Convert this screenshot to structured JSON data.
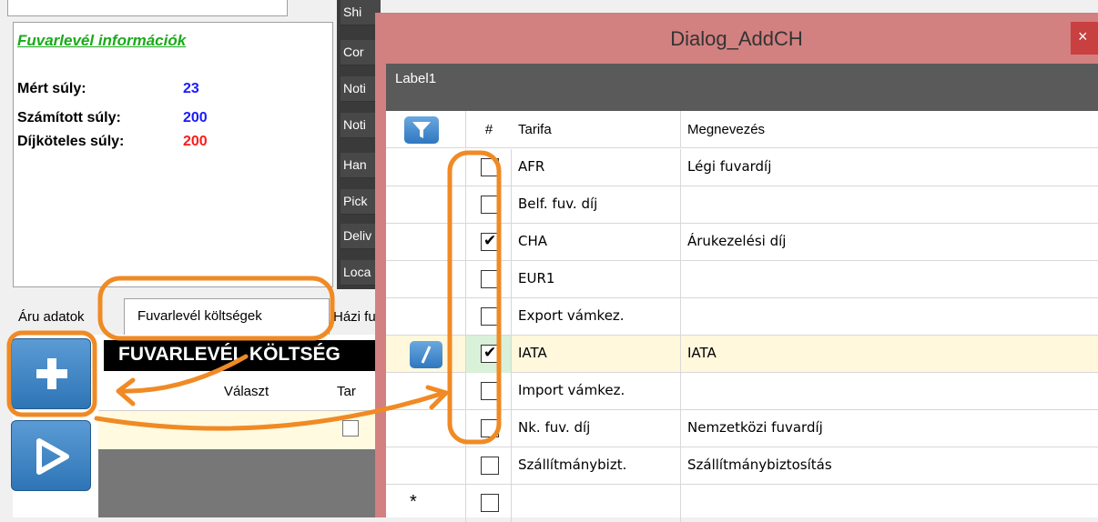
{
  "info": {
    "title": "Fuvarlevél információk",
    "rows": [
      {
        "label": "Mért súly:",
        "value": "23",
        "color": "#1a1aff"
      },
      {
        "label": "Számított súly:",
        "value": "200",
        "color": "#1a1aff"
      },
      {
        "label": "Díjköteles súly:",
        "value": "200",
        "color": "#ff1a1a"
      }
    ]
  },
  "dark_strip": [
    "Shi",
    "Cor",
    "Noti",
    "Noti",
    "Han",
    "Pick",
    "Deliv",
    "Loca"
  ],
  "tabs": {
    "aru": "Áru adatok",
    "fuv": "Fuvarlevél költségek",
    "hazi": "Házi fu"
  },
  "costs": {
    "header": "FUVARLEVÉL KÖLTSÉG",
    "col_valaszt": "Választ",
    "col_tar": "Tar"
  },
  "dialog": {
    "title": "Dialog_AddCH",
    "close": "×",
    "label": "Label1",
    "headers": {
      "hash": "#",
      "tarifa": "Tarifa",
      "megnevezes": "Megnevezés"
    },
    "rows": [
      {
        "tarifa": "AFR",
        "megnevezes": "Légi fuvardíj",
        "checked": false
      },
      {
        "tarifa": "Belf. fuv. díj",
        "megnevezes": "",
        "checked": false
      },
      {
        "tarifa": "CHA",
        "megnevezes": "Árukezelési díj",
        "checked": true
      },
      {
        "tarifa": "EUR1",
        "megnevezes": "",
        "checked": false
      },
      {
        "tarifa": "Export vámkez.",
        "megnevezes": "",
        "checked": false
      },
      {
        "tarifa": "IATA",
        "megnevezes": "IATA",
        "checked": true,
        "editing": true
      },
      {
        "tarifa": "Import vámkez.",
        "megnevezes": "",
        "checked": false
      },
      {
        "tarifa": "Nk. fuv. díj",
        "megnevezes": "Nemzetközi fuvardíj",
        "checked": false
      },
      {
        "tarifa": "Szállítmánybizt.",
        "megnevezes": "Szállítmánybiztosítás",
        "checked": false
      }
    ],
    "new_row_marker": "*"
  },
  "colors": {
    "annotation": "#f08a24",
    "accent_blue": "#2e75b6"
  }
}
